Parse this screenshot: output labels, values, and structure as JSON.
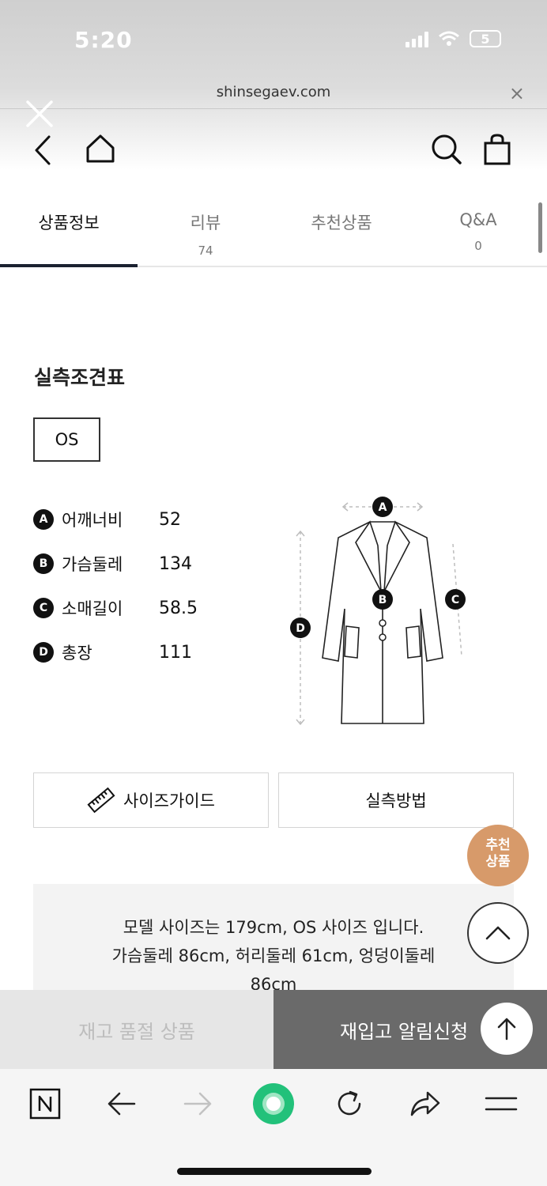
{
  "status": {
    "time": "5:20",
    "battery": "5"
  },
  "browser": {
    "url": "shinsegaev.com",
    "close": "×"
  },
  "tabs": [
    {
      "label": "상품정보",
      "count": ""
    },
    {
      "label": "리뷰",
      "count": "74"
    },
    {
      "label": "추천상품",
      "count": ""
    },
    {
      "label": "Q&A",
      "count": "0"
    }
  ],
  "size_chart": {
    "title": "실측조견표",
    "selected_size": "OS",
    "rows": [
      {
        "key": "A",
        "label": "어깨너비",
        "value": "52"
      },
      {
        "key": "B",
        "label": "가슴둘레",
        "value": "134"
      },
      {
        "key": "C",
        "label": "소매길이",
        "value": "58.5"
      },
      {
        "key": "D",
        "label": "총장",
        "value": "111"
      }
    ]
  },
  "buttons": {
    "size_guide": "사이즈가이드",
    "measure_method": "실측방법"
  },
  "recommend_badge": {
    "line1": "추천",
    "line2": "상품"
  },
  "model_info": {
    "line1": "모델 사이즈는 179cm, OS 사이즈 입니다.",
    "line2": "가슴둘레 86cm, 허리둘레 61cm, 엉덩이둘레",
    "line3": "86cm"
  },
  "purchase_bar": {
    "sold_out": "재고 품절 상품",
    "restock": "재입고 알림신청"
  },
  "colors": {
    "tab_underline": "#1b2130",
    "recommend_badge": "#d79a6a",
    "restock_bg": "#6a6a6a",
    "browser_record": "#22c17a"
  }
}
